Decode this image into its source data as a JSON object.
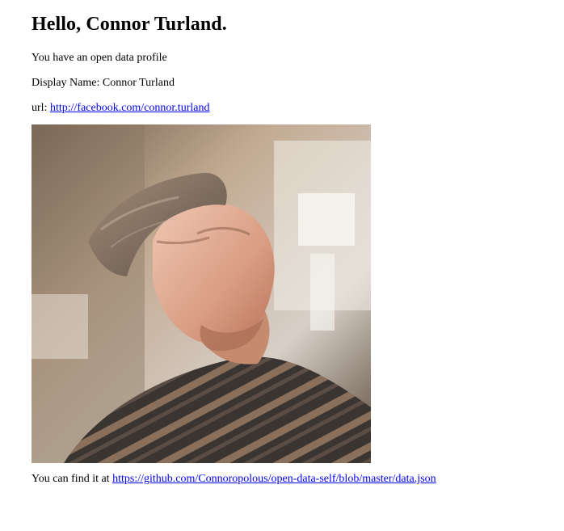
{
  "greeting": "Hello, Connor Turland.",
  "status_text": "You have an open data profile",
  "display_name": {
    "label": "Display Name:",
    "value": "Connor Turland"
  },
  "url": {
    "label": "url:",
    "link_text": "http://facebook.com/connor.turland"
  },
  "profile_photo": {
    "icon": "profile-photo"
  },
  "find_it": {
    "prefix": "You can find it at",
    "link_text": "https://github.com/Connoropolous/open-data-self/blob/master/data.json"
  }
}
